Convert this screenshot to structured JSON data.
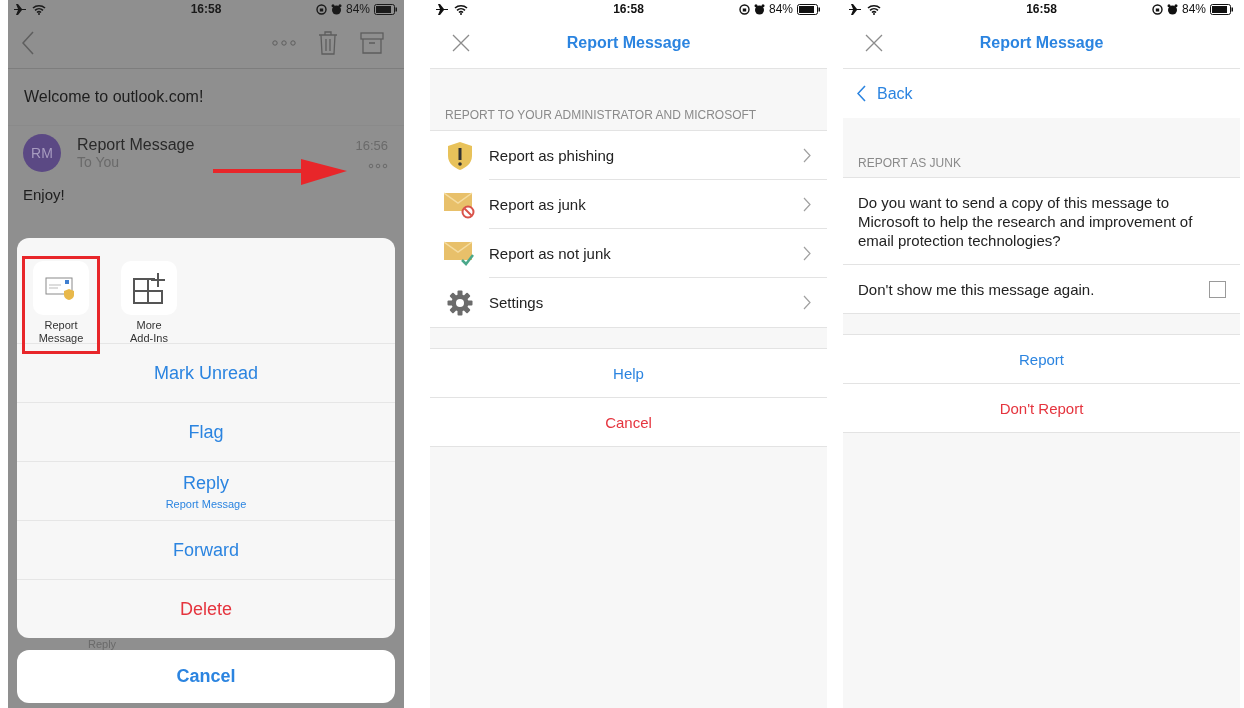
{
  "screens": [
    {
      "kind": "message",
      "status_bar": {
        "time": "16:58",
        "battery": "84%"
      },
      "subject": "Welcome to outlook.com!",
      "message": {
        "avatar": "RM",
        "sender": "Report Message",
        "recipient": "To You",
        "time": "16:56",
        "body": "Enjoy!"
      },
      "action_sheet": {
        "addins": [
          {
            "label": "Report Message",
            "kind": "report",
            "highlighted": true
          },
          {
            "label": "More Add-Ins",
            "kind": "more",
            "highlighted": false
          }
        ],
        "actions": [
          {
            "label": "Mark Unread",
            "kind": "normal"
          },
          {
            "label": "Flag",
            "kind": "normal"
          },
          {
            "label": "Reply",
            "subtitle": "Report Message",
            "kind": "normal"
          },
          {
            "label": "Forward",
            "kind": "normal"
          },
          {
            "label": "Delete",
            "kind": "destructive"
          }
        ],
        "cancel": "Cancel"
      },
      "reply_bar": {
        "label": "Reply"
      }
    },
    {
      "kind": "report",
      "status_bar": {
        "time": "16:58",
        "battery": "84%"
      },
      "title": "Report Message",
      "section_header": "REPORT TO YOUR ADMINISTRATOR AND MICROSOFT",
      "items": [
        {
          "label": "Report as phishing",
          "kind": "phishing"
        },
        {
          "label": "Report as junk",
          "kind": "junk"
        },
        {
          "label": "Report as not junk",
          "kind": "not-junk"
        },
        {
          "label": "Settings",
          "kind": "settings"
        }
      ],
      "buttons": [
        {
          "label": "Help",
          "kind": "primary"
        },
        {
          "label": "Cancel",
          "kind": "destructive"
        }
      ]
    },
    {
      "kind": "junk",
      "status_bar": {
        "time": "16:58",
        "battery": "84%"
      },
      "title": "Report Message",
      "back": "Back",
      "section_header": "REPORT AS JUNK",
      "question": "Do you want to send a copy of this message to Microsoft to help the research and improvement of email protection technologies?",
      "option": {
        "label": "Don't show me this message again.",
        "checked": false
      },
      "buttons": [
        {
          "label": "Report",
          "kind": "primary"
        },
        {
          "label": "Don't Report",
          "kind": "destructive"
        }
      ]
    }
  ]
}
